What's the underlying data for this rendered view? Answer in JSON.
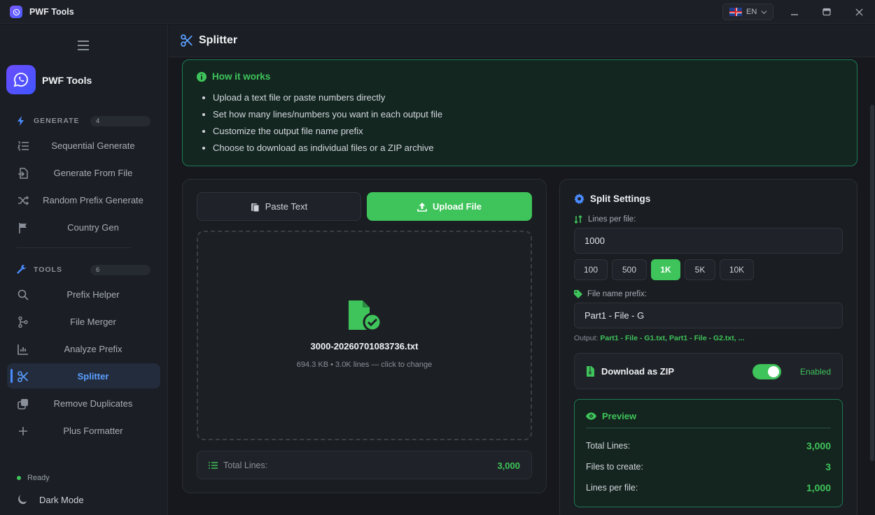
{
  "app": {
    "title": "PWF Tools",
    "lang": "EN"
  },
  "sidebar": {
    "brand": "PWF Tools",
    "generate": {
      "label": "GENERATE",
      "count": "4",
      "items": [
        {
          "label": "Sequential Generate",
          "icon": "list-ordered-icon"
        },
        {
          "label": "Generate From File",
          "icon": "file-import-icon"
        },
        {
          "label": "Random Prefix Generate",
          "icon": "shuffle-icon"
        },
        {
          "label": "Country Gen",
          "icon": "flag-icon"
        }
      ]
    },
    "tools": {
      "label": "TOOLS",
      "count": "6",
      "items": [
        {
          "label": "Prefix Helper",
          "icon": "search-icon"
        },
        {
          "label": "File Merger",
          "icon": "merge-icon"
        },
        {
          "label": "Analyze Prefix",
          "icon": "chart-icon"
        },
        {
          "label": "Splitter",
          "icon": "scissors-icon"
        },
        {
          "label": "Remove Duplicates",
          "icon": "copy-icon"
        },
        {
          "label": "Plus Formatter",
          "icon": "plus-icon"
        }
      ]
    },
    "status": "Ready",
    "dark_mode": "Dark Mode"
  },
  "header": {
    "title": "Splitter"
  },
  "how_it_works": {
    "title": "How it works",
    "steps": [
      "Upload a text file or paste numbers directly",
      "Set how many lines/numbers you want in each output file",
      "Customize the output file name prefix",
      "Choose to download as individual files or a ZIP archive"
    ]
  },
  "input_panel": {
    "tabs": {
      "paste": "Paste Text",
      "upload": "Upload File"
    },
    "file_name": "3000-20260701083736.txt",
    "file_meta": "694.3 KB • 3.0K lines — click to change",
    "total_label": "Total Lines:",
    "total_value": "3,000"
  },
  "settings": {
    "title": "Split Settings",
    "lines_label": "Lines per file:",
    "lines_value": "1000",
    "presets": [
      "100",
      "500",
      "1K",
      "5K",
      "10K"
    ],
    "prefix_label": "File name prefix:",
    "prefix_value": "Part1 - File - G",
    "output_label": "Output:",
    "output_value": "Part1 - File - G1.txt, Part1 - File - G2.txt, ...",
    "zip_label": "Download as ZIP",
    "zip_status": "Enabled",
    "zip_enabled": true
  },
  "preview": {
    "title": "Preview",
    "rows": [
      {
        "label": "Total Lines:",
        "value": "3,000"
      },
      {
        "label": "Files to create:",
        "value": "3"
      },
      {
        "label": "Lines per file:",
        "value": "1,000"
      }
    ]
  },
  "colors": {
    "accent": "#3ec45a",
    "blue": "#4a8cff",
    "brand": "#6c4dff"
  }
}
